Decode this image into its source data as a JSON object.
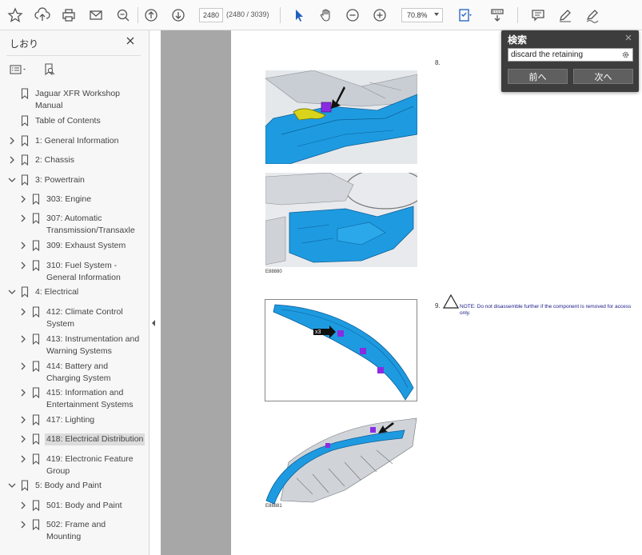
{
  "toolbar": {
    "page_current": "2480",
    "page_total": "(2480 / 3039)",
    "zoom": "70.8%",
    "icons": [
      "bookmark-star-icon",
      "upload-icon",
      "print-icon",
      "email-icon",
      "zoom-search-icon",
      "page-up-icon",
      "page-down-icon",
      "select-arrow-icon",
      "hand-icon",
      "zoom-out-icon",
      "zoom-in-icon",
      "fit-page-icon",
      "scroll-mode-icon",
      "comment-icon",
      "pen-icon",
      "sign-icon"
    ]
  },
  "sidebar": {
    "title": "しおり",
    "items": [
      {
        "label": "Jaguar XFR Workshop Manual",
        "lines": [
          "Jaguar XFR Workshop",
          "Manual"
        ],
        "level": 0,
        "chevron": "none"
      },
      {
        "label": "Table of Contents",
        "lines": [
          "Table of Contents"
        ],
        "level": 0,
        "chevron": "none"
      },
      {
        "label": "1: General Information",
        "lines": [
          "1: General Information"
        ],
        "level": 0,
        "chevron": "right"
      },
      {
        "label": "2: Chassis",
        "lines": [
          "2: Chassis"
        ],
        "level": 0,
        "chevron": "right"
      },
      {
        "label": "3: Powertrain",
        "lines": [
          "3: Powertrain"
        ],
        "level": 0,
        "chevron": "down"
      },
      {
        "label": "303: Engine",
        "lines": [
          "303: Engine"
        ],
        "level": 1,
        "chevron": "right"
      },
      {
        "label": "307: Automatic Transmission/Transaxle",
        "lines": [
          "307: Automatic",
          "Transmission/Transaxle"
        ],
        "level": 1,
        "chevron": "right"
      },
      {
        "label": "309: Exhaust System",
        "lines": [
          "309: Exhaust System"
        ],
        "level": 1,
        "chevron": "right"
      },
      {
        "label": "310: Fuel System - General Information",
        "lines": [
          "310: Fuel System -",
          "General Information"
        ],
        "level": 1,
        "chevron": "right"
      },
      {
        "label": "4: Electrical",
        "lines": [
          "4: Electrical"
        ],
        "level": 0,
        "chevron": "down"
      },
      {
        "label": "412: Climate Control System",
        "lines": [
          "412: Climate Control",
          "System"
        ],
        "level": 1,
        "chevron": "right"
      },
      {
        "label": "413: Instrumentation and Warning Systems",
        "lines": [
          "413: Instrumentation and",
          "Warning Systems"
        ],
        "level": 1,
        "chevron": "right"
      },
      {
        "label": "414: Battery and Charging System",
        "lines": [
          "414: Battery and",
          "Charging System"
        ],
        "level": 1,
        "chevron": "right"
      },
      {
        "label": "415: Information and Entertainment Systems",
        "lines": [
          "415: Information and",
          "Entertainment Systems"
        ],
        "level": 1,
        "chevron": "right"
      },
      {
        "label": "417: Lighting",
        "lines": [
          "417: Lighting"
        ],
        "level": 1,
        "chevron": "right"
      },
      {
        "label": "418: Electrical Distribution",
        "lines": [
          "418: Electrical Distribution"
        ],
        "level": 1,
        "chevron": "right",
        "selected": true
      },
      {
        "label": "419: Electronic Feature Group",
        "lines": [
          "419: Electronic Feature",
          "Group"
        ],
        "level": 1,
        "chevron": "right"
      },
      {
        "label": "5: Body and Paint",
        "lines": [
          "5: Body and Paint"
        ],
        "level": 0,
        "chevron": "down"
      },
      {
        "label": "501: Body and Paint",
        "lines": [
          "501: Body and Paint"
        ],
        "level": 1,
        "chevron": "right"
      },
      {
        "label": "502: Frame and Mounting",
        "lines": [
          "502: Frame and",
          "Mounting"
        ],
        "level": 1,
        "chevron": "right"
      }
    ]
  },
  "document": {
    "step_8": "8.",
    "step_9": "9.",
    "caption_1": "E88880",
    "caption_2": "E88881",
    "callout": "x3",
    "note": "NOTE: Do not disassemble further if the component is removed for access only."
  },
  "find": {
    "title": "検索",
    "query": "discard the retaining",
    "prev_label": "前へ",
    "next_label": "次へ"
  },
  "colors": {
    "accent_blue": "#1f5fbf",
    "part_blue": "#1e9be0",
    "highlight_purple": "#8a2be2",
    "toolbar_bg": "#fafafa",
    "viewport_bg": "#a7a7a7",
    "find_bg": "#3d3d3d"
  }
}
